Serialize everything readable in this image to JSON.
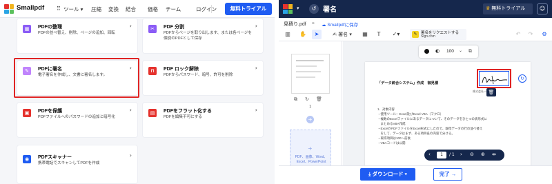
{
  "left": {
    "brand": "Smallpdf",
    "nav": {
      "tools": "ツール",
      "compress": "圧縮",
      "convert": "変換",
      "merge": "結合",
      "pricing": "価格",
      "team": "チーム",
      "login": "ログイン",
      "trial": "無料トライアル"
    },
    "cards": [
      {
        "title": "PDFの整理",
        "desc": "PDFの並べ替え、削除、ページの追加、回転"
      },
      {
        "title": "PDF 分割",
        "desc": "PDFからページを取り出します、または各ページを個別のPDFとして保存"
      },
      {
        "title": "PDFに署名",
        "desc": "電子署名を作成し、文書に署名します。"
      },
      {
        "title": "PDF ロック解除",
        "desc": "PDFからパスワード、暗号、許可を削除"
      },
      {
        "title": "PDFを保護",
        "desc": "PDFファイルへのパスワードの追加と暗号化"
      },
      {
        "title": "PDFをフラット化する",
        "desc": "PDFを編集不可にする"
      },
      {
        "title": "PDFスキャナー",
        "desc": "携帯電話でスキャンしてPDFを作成"
      }
    ]
  },
  "right": {
    "title": "署名",
    "trial": "無料トライアル",
    "filename": "見積り.pdf",
    "saved": "Smallpdfに保存",
    "toolbar": {
      "sign": "署名",
      "sig_request": "署名をリクエストする",
      "sig_request_sub": "Sign.com"
    },
    "opacity": "100",
    "thumb_page": "1",
    "upload_hint": "PDF、画像、Word、Excel、PowerPoint",
    "doc": {
      "heading": "「データ統合システム」作成　御見積",
      "lines": [
        "1．対象内容",
        "・使用ツール：Excel及びExcel VBA（マクロ）",
        "・複数のExcelファイルにあるデータについて、そのデータをひとつの表形式に",
        "　まとめるVBA作成",
        "・ExcelかPDFファイルをExcel形式にしたので、取得データの行の並べ替え",
        "　をして、データはまず、ある項目名の内容で分ける。",
        "・取得項目は100～前後",
        "・VBAコードは公開",
        "2．調査等"
      ],
      "small": "株式会社○○○"
    },
    "pager": {
      "current": "1",
      "total": "/ 1"
    },
    "download": "ダウンロード",
    "done": "完了"
  },
  "colors": {
    "accent": "#1f5cf2",
    "navy": "#15274c",
    "selection": "#e02424"
  }
}
